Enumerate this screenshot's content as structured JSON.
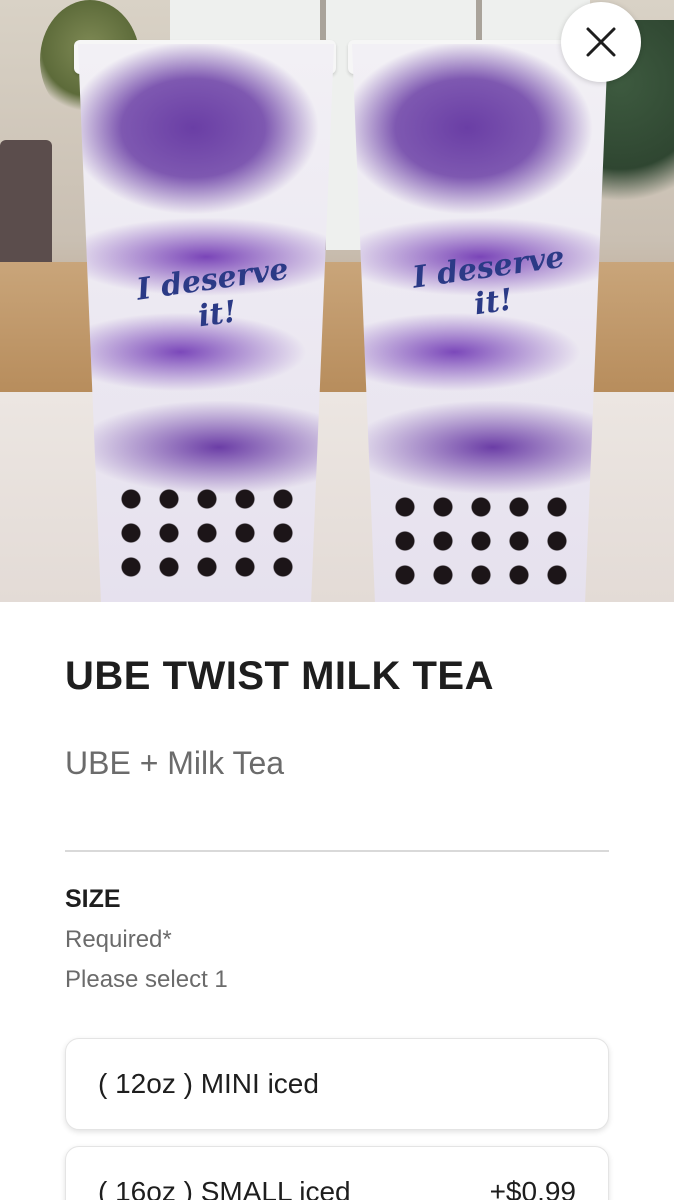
{
  "item": {
    "name": "UBE TWIST MILK TEA",
    "description": "UBE + Milk Tea"
  },
  "hero_image": {
    "cup_text_left": "I deserve it!",
    "cup_text_right": "I deserve it!"
  },
  "size_section": {
    "heading": "SIZE",
    "required": "Required*",
    "instruction": "Please select 1",
    "options": [
      {
        "label": "( 12oz ) MINI iced",
        "price": ""
      },
      {
        "label": "( 16oz ) SMALL iced",
        "price": "+$0.99"
      }
    ]
  },
  "icons": {
    "close": "close-icon"
  }
}
